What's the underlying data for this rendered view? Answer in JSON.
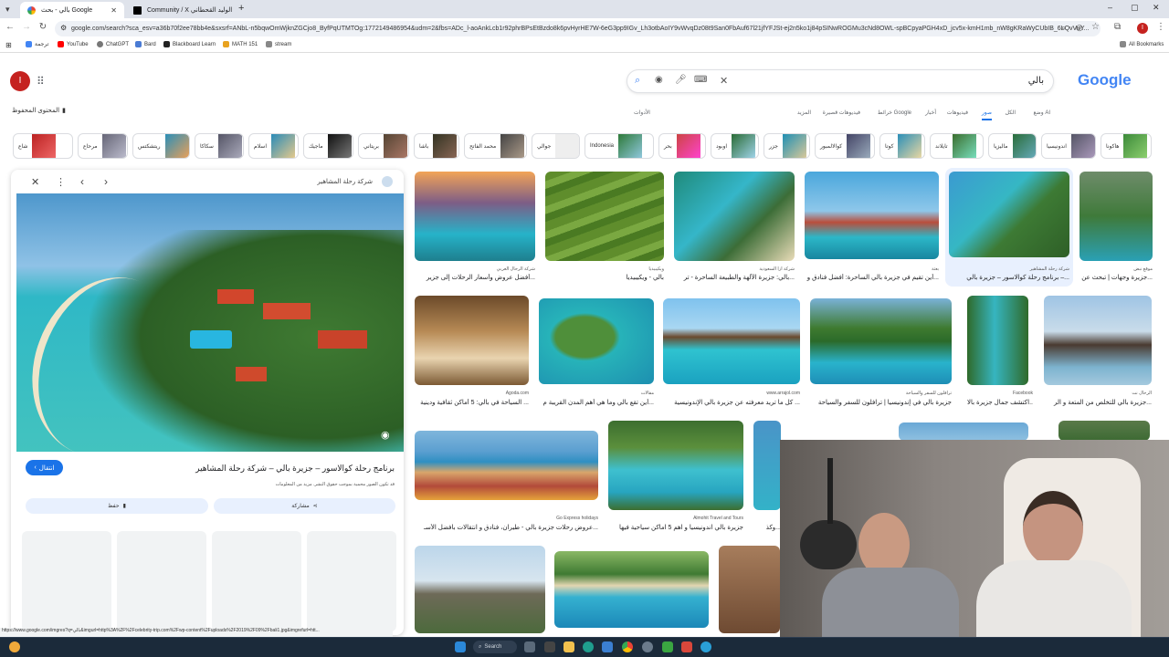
{
  "browser": {
    "tabs": [
      {
        "label": "بالي - بحث Google"
      },
      {
        "label": "Community / X الوليد القحطاني"
      }
    ],
    "new_tab": "+",
    "url": "google.com/search?sca_esv=a36b70f2ee78bb4e&sxsrf=ANbL-n5bqwOmWjknZGCjo8_ByfPqUTMTOg:1772149486954&udm=2&fbs=ADc_l-aoAnkLcb1r92phrBPsEtBzdo8k6pvHyrHE7W-6eG3pp9IGv_Lh3otbAoIY9vWvqDz08t9San0FbAuf67l21jfYFJSt-ej2n5ko1j84pSINwROGMu3cNd8OWL-spBCpyaPGH4xD_jcv5x-kmH1mb_nW8gKRaWyCUbIB_6LQvVuY...",
    "bookmarks": [
      "ترجمة",
      "YouTube",
      "ChatGPT",
      "Bard",
      "Blackboard Learn",
      "MATH 151",
      "stream"
    ],
    "all_bookmarks": "All Bookmarks",
    "avatar_letter": "I"
  },
  "google": {
    "logo": "Google",
    "query": "بالي",
    "saved": "المحتوى المحفوظ",
    "tabs": [
      "وضع AI",
      "الكل",
      "صور",
      "فيديوهات",
      "أخبار",
      "خرائط Google",
      "فيديوهات قصيرة",
      "المزيد"
    ],
    "tools": "الأدوات",
    "chips": [
      "هاكونا",
      "اندونيسيا",
      "ماليزيا",
      "تايلاند",
      "كوتا",
      "كوالالمبور",
      "جزر",
      "اوبود",
      "بحر",
      "Indonesia",
      "جوالي",
      "محمد الفاتح",
      "باشا",
      "بريتاني",
      "ماجيك",
      "اسلام",
      "سكاكا",
      "ريتشكتس",
      "مرحاع",
      "شاع"
    ]
  },
  "panel": {
    "source": "شركة رحلة المشاهير",
    "title": "برنامج رحلة كوالاسور – جزيرة بالي – شركة رحلة المشاهير",
    "subtitle": "قد تكون الصور محمية بموجب حقوق النشر. مزيد من المعلومات",
    "visit": "انتقال",
    "share": "مشاركة",
    "save": "حفظ"
  },
  "results": {
    "row1": [
      {
        "src": "شركة الرحال العربي",
        "title": "أفضل عروض وأسعار الرحلات إلى جزير..."
      },
      {
        "src": "ويكيبيديا",
        "title": "بالي - ويكيبيديا"
      },
      {
        "src": "شركة ازا السعودية",
        "title": "بالي: جزيرة الآلهة والطبيعة الساحرة - تر..."
      },
      {
        "src": "بعثة",
        "title": "أين تقيم في جزيرة بالي الساحرة: أفضل فنادق و..."
      },
      {
        "src": "شركة رحلة المشاهير",
        "title": "برنامج رحلة كوالاسور – جزيرة بالي –..."
      },
      {
        "src": "موقع نبض",
        "title": "جزيرة وجهات | تبحث عن..."
      }
    ],
    "row2": [
      {
        "src": "Agoda.com",
        "title": "السياحة في بالي: 5 أماكن ثقافية ودينية ..."
      },
      {
        "src": "مقالات",
        "title": "أين تقع بالي وما هي أهم المدن القريبة م..."
      },
      {
        "src": "www.arrajol.com",
        "title": "كل ما تريد معرفته عن جزيرة بالي الإندونيسية ..."
      },
      {
        "src": "ترافلون للسفر والسياحة",
        "title": "جزيرة بالي في إندونيسيا | ترافلون للسفر والسياحة"
      },
      {
        "src": "Facebook",
        "title": "اكتشف جمال جزيرة بالا..."
      },
      {
        "src": "الرحال نت",
        "title": "جزيرة بالي للتخلص من المتعة و الر..."
      }
    ],
    "row3": [
      {
        "src": "Go Express holidays",
        "title": "عروض رحلات جزيرة بالي - طيران، فنادق و انتقالات بأفضل الأسـ..."
      },
      {
        "src": "Almohit Travel and Tours",
        "title": "جزيرة بالي اندونيسيا و اهم 5 اماكن سياحية فيها"
      },
      {
        "src": "",
        "title": "وكذ..."
      }
    ]
  },
  "status_url": "https://www.google.com/imgres?q=بالي&imgurl=http%3A%2F%2Fcelebrity-trip.com%2Fwp-content%2Fuploads%2F2019%2F09%2Fbali1.jpg&imgrefurl=htt...",
  "taskbar": {
    "search": "Search"
  }
}
